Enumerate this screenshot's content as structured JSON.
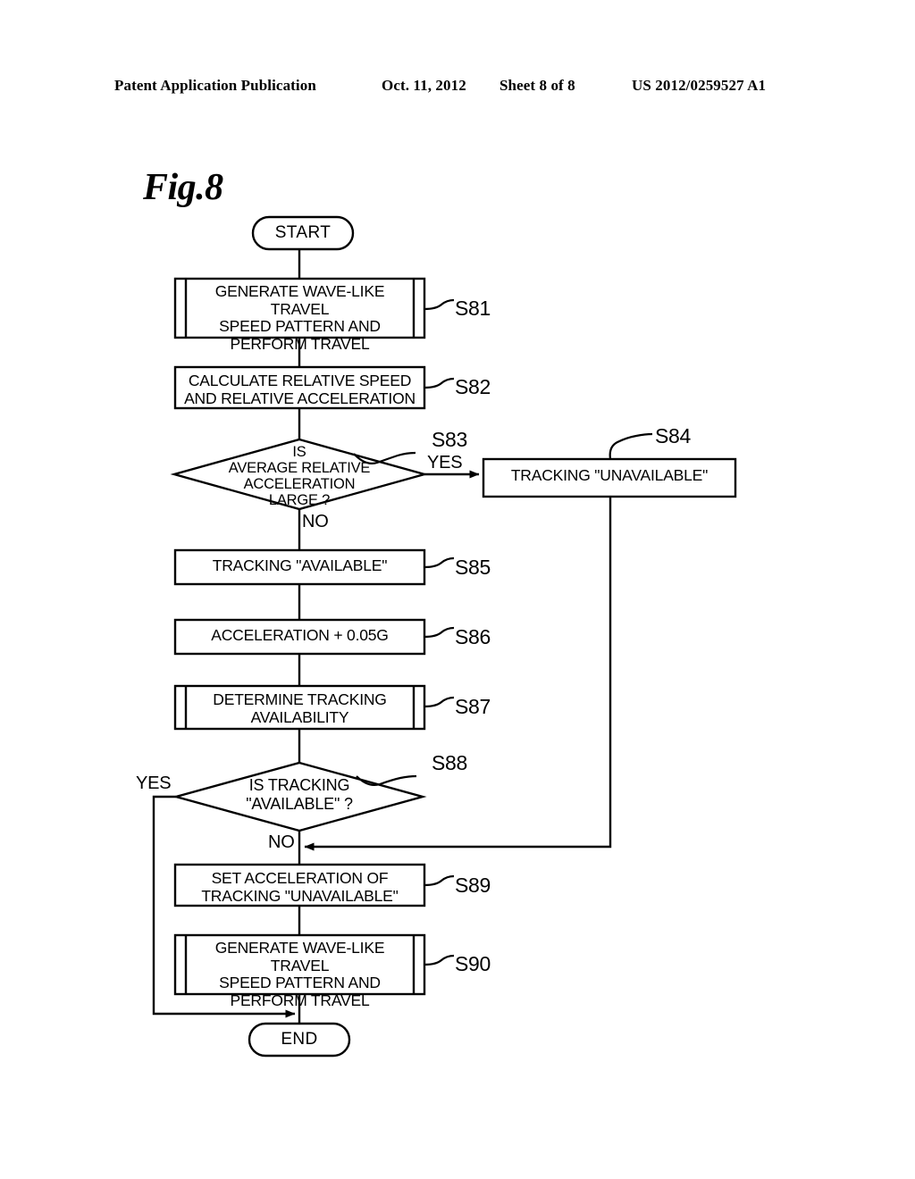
{
  "header": {
    "publication": "Patent Application Publication",
    "date": "Oct. 11, 2012",
    "sheet": "Sheet 8 of 8",
    "document_number": "US 2012/0259527 A1"
  },
  "figure": {
    "label": "Fig.8"
  },
  "flowchart": {
    "start": {
      "label": "START"
    },
    "end": {
      "label": "END"
    },
    "nodes": [
      {
        "id": "S81",
        "tag": "S81",
        "shape": "predefined-process",
        "text": "GENERATE WAVE-LIKE TRAVEL\nSPEED PATTERN AND\nPERFORM TRAVEL"
      },
      {
        "id": "S82",
        "tag": "S82",
        "shape": "process",
        "text": "CALCULATE RELATIVE SPEED\nAND RELATIVE ACCELERATION"
      },
      {
        "id": "S83",
        "tag": "S83",
        "shape": "decision",
        "text": "IS\nAVERAGE RELATIVE\nACCELERATION\nLARGE ?"
      },
      {
        "id": "S84",
        "tag": "S84",
        "shape": "process",
        "text": "TRACKING \"UNAVAILABLE\""
      },
      {
        "id": "S85",
        "tag": "S85",
        "shape": "process",
        "text": "TRACKING \"AVAILABLE\""
      },
      {
        "id": "S86",
        "tag": "S86",
        "shape": "process",
        "text": "ACCELERATION + 0.05G"
      },
      {
        "id": "S87",
        "tag": "S87",
        "shape": "predefined-process",
        "text": "DETERMINE TRACKING\nAVAILABILITY"
      },
      {
        "id": "S88",
        "tag": "S88",
        "shape": "decision",
        "text": "IS TRACKING\n\"AVAILABLE\" ?"
      },
      {
        "id": "S89",
        "tag": "S89",
        "shape": "process",
        "text": "SET ACCELERATION OF\nTRACKING \"UNAVAILABLE\""
      },
      {
        "id": "S90",
        "tag": "S90",
        "shape": "predefined-process",
        "text": "GENERATE WAVE-LIKE TRAVEL\nSPEED PATTERN AND\nPERFORM TRAVEL"
      }
    ],
    "branch_labels": {
      "s83_yes": "YES",
      "s83_no": "NO",
      "s88_yes": "YES",
      "s88_no": "NO"
    }
  },
  "colors": {
    "stroke": "#000000",
    "background": "#ffffff"
  }
}
